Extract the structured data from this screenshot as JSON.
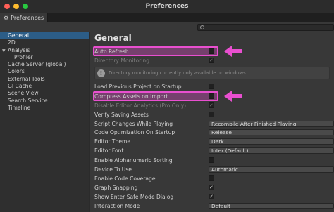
{
  "window": {
    "title": "Preferences"
  },
  "tab": {
    "label": "Preferences"
  },
  "search": {
    "placeholder": ""
  },
  "sidebar": {
    "items": [
      {
        "label": "General",
        "selected": true
      },
      {
        "label": "2D"
      },
      {
        "label": "Analysis",
        "expanded": true
      },
      {
        "label": "Profiler",
        "child": true
      },
      {
        "label": "Cache Server (global)"
      },
      {
        "label": "Colors"
      },
      {
        "label": "External Tools"
      },
      {
        "label": "GI Cache"
      },
      {
        "label": "Scene View"
      },
      {
        "label": "Search Service"
      },
      {
        "label": "Timeline"
      }
    ]
  },
  "content": {
    "title": "General",
    "help_text": "Directory monitoring currently only available on windows",
    "rows": [
      {
        "label": "Auto Refresh",
        "control": "checkbox",
        "checked": false,
        "highlighted": true
      },
      {
        "label": "Directory Monitoring",
        "control": "checkbox",
        "checked": true,
        "disabled": true
      },
      {
        "label": "Load Previous Project on Startup",
        "control": "checkbox",
        "checked": false
      },
      {
        "label": "Compress Assets on Import",
        "control": "checkbox",
        "checked": false,
        "highlighted": true
      },
      {
        "label": "Disable Editor Analytics (Pro Only)",
        "control": "checkbox",
        "checked": true,
        "disabled": true
      },
      {
        "label": "Verify Saving Assets",
        "control": "checkbox",
        "checked": false
      },
      {
        "label": "Script Changes While Playing",
        "control": "dropdown",
        "value": "Recompile After Finished Playing"
      },
      {
        "label": "Code Optimization On Startup",
        "control": "dropdown",
        "value": "Release"
      },
      {
        "label": "Editor Theme",
        "control": "dropdown",
        "value": "Dark"
      },
      {
        "label": "Editor Font",
        "control": "dropdown",
        "value": "Inter (Default)"
      },
      {
        "label": "Enable Alphanumeric Sorting",
        "control": "checkbox",
        "checked": false
      },
      {
        "label": "Device To Use",
        "control": "dropdown",
        "value": "Automatic"
      },
      {
        "label": "Enable Code Coverage",
        "control": "checkbox",
        "checked": false
      },
      {
        "label": "Graph Snapping",
        "control": "checkbox",
        "checked": true
      },
      {
        "label": "Show Enter Safe Mode Dialog",
        "control": "checkbox",
        "checked": true
      },
      {
        "label": "Interaction Mode",
        "control": "dropdown",
        "value": "Default"
      }
    ]
  },
  "colors": {
    "highlight": "#e94fd0",
    "selection": "#2c5d87",
    "panel": "#383838"
  },
  "check_glyph": "✓"
}
